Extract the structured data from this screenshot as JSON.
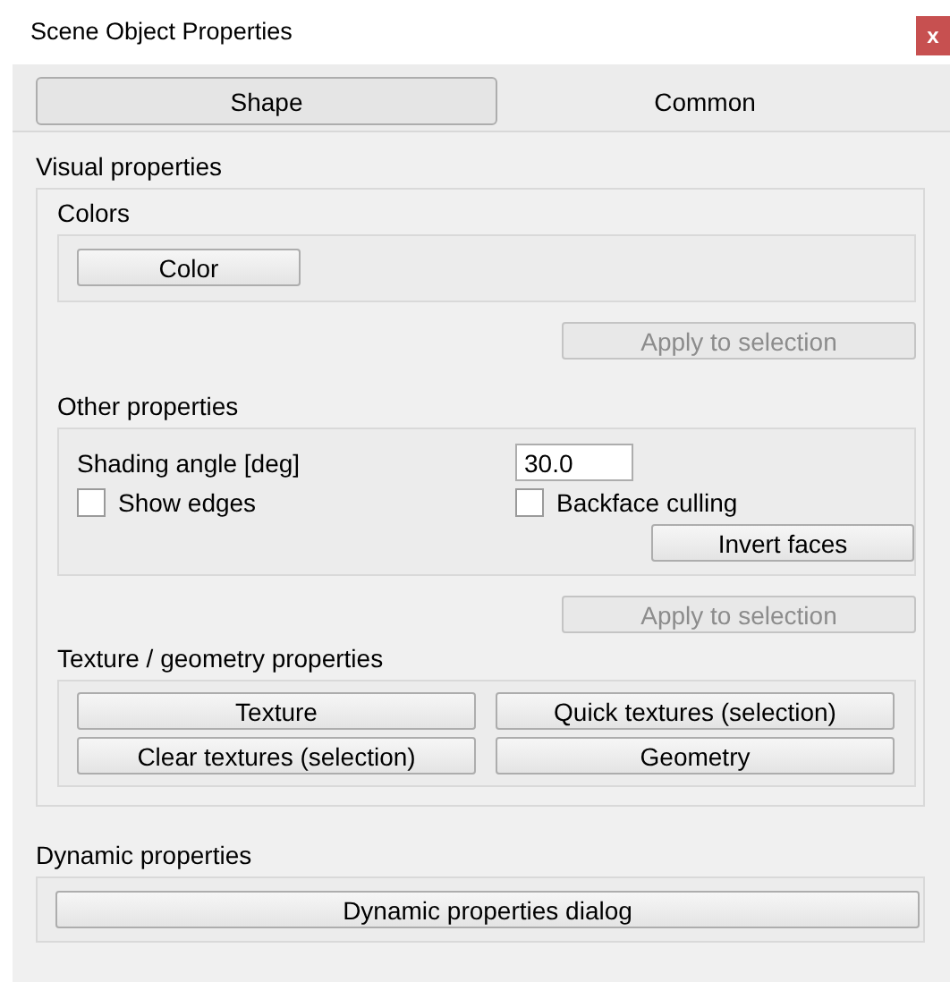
{
  "window": {
    "title": "Scene Object Properties",
    "close": "x"
  },
  "tabs": [
    {
      "label": "Shape",
      "selected": true
    },
    {
      "label": "Common",
      "selected": false
    }
  ],
  "visual_properties": {
    "label": "Visual properties",
    "colors": {
      "label": "Colors",
      "button": {
        "label": "Color",
        "disabled": false
      },
      "apply": {
        "label": "Apply to selection",
        "disabled": true
      }
    },
    "other": {
      "label": "Other properties",
      "shading_label": "Shading angle [deg]",
      "shading_value": "30.0",
      "checkboxes": [
        {
          "label": "Show edges",
          "checked": false
        },
        {
          "label": "Backface culling",
          "checked": false
        }
      ],
      "invert": {
        "label": "Invert faces",
        "disabled": false
      },
      "apply": {
        "label": "Apply to selection",
        "disabled": true
      }
    },
    "texture": {
      "label": "Texture / geometry properties",
      "buttons": [
        {
          "label": "Texture",
          "disabled": false
        },
        {
          "label": "Quick textures (selection)",
          "disabled": false
        },
        {
          "label": "Clear textures (selection)",
          "disabled": false
        },
        {
          "label": "Geometry",
          "disabled": false
        }
      ]
    }
  },
  "dynamic_properties": {
    "label": "Dynamic properties",
    "button": {
      "label": "Dynamic properties dialog",
      "disabled": false
    }
  }
}
